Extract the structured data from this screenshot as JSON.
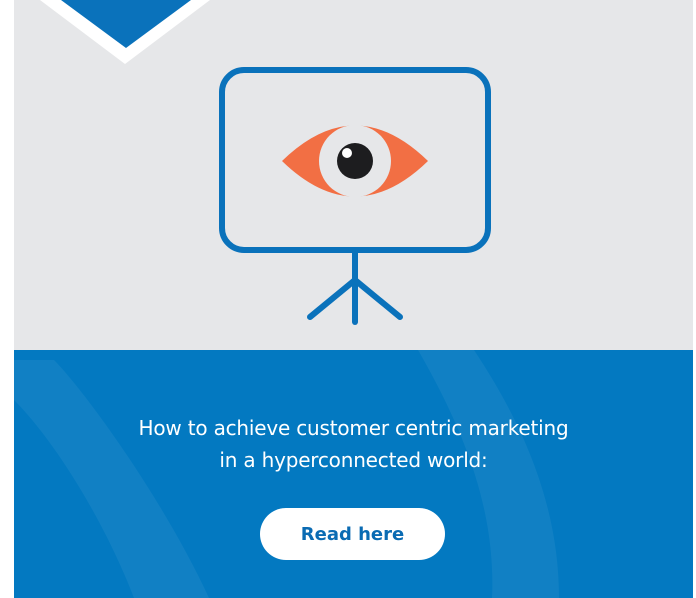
{
  "hero": {
    "illustration_icon": "presentation-screen-with-eye-icon",
    "colors": {
      "background": "#e6e7e9",
      "screen_stroke": "#0a72bb",
      "eye": "#f26f44",
      "badge": "#0a72bb"
    }
  },
  "panel": {
    "headline_line1": "How to achieve customer centric marketing",
    "headline_line2": "in a hyperconnected world:",
    "cta_label": "Read here",
    "colors": {
      "background": "#0379c1",
      "button_bg": "#ffffff",
      "button_text": "#0a6bb3"
    }
  }
}
